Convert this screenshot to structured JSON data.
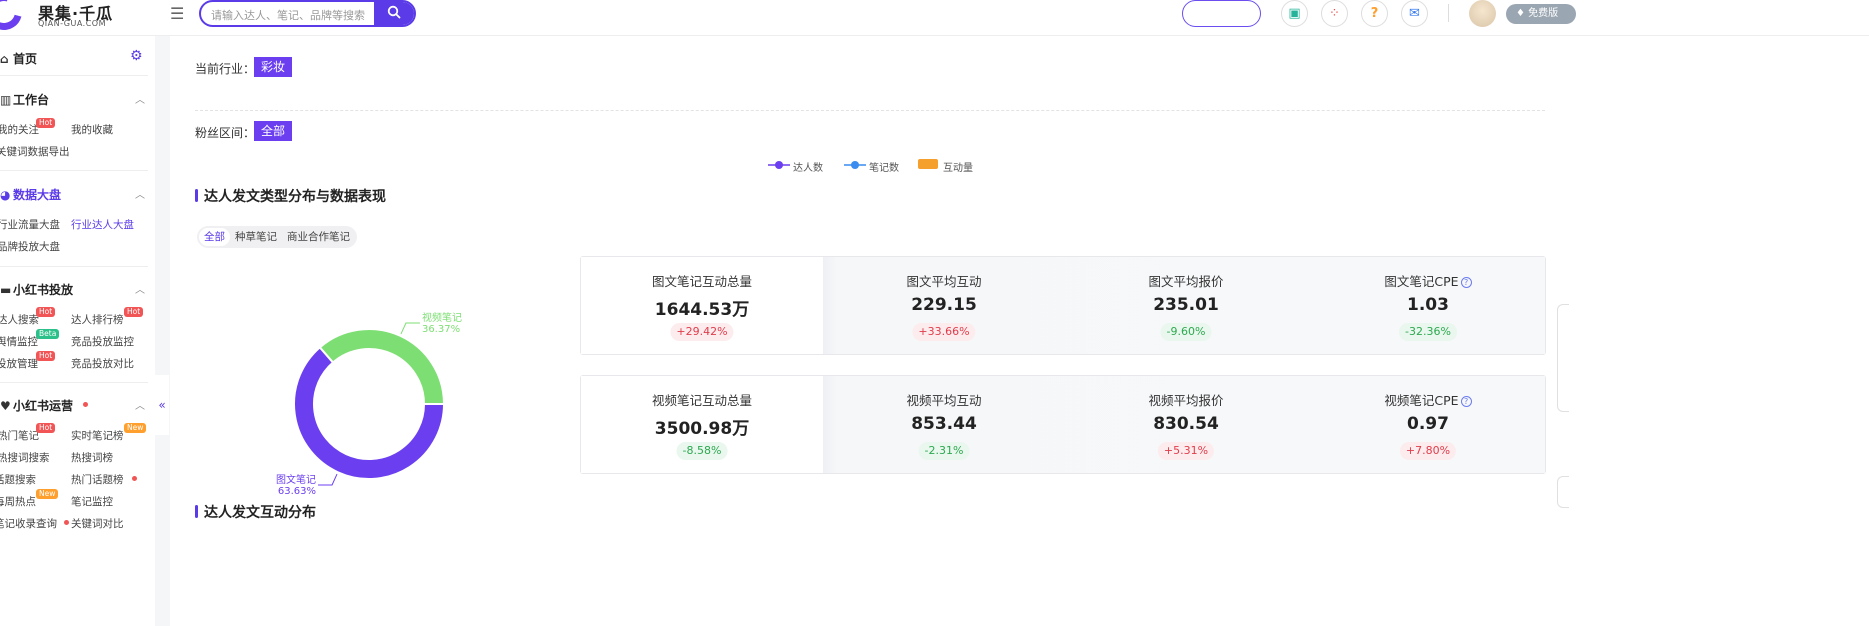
{
  "header": {
    "logo_text": "果集·千瓜",
    "logo_sub": "QIAN-GUA.COM",
    "search_placeholder": "请输入达人、笔记、品牌等搜索",
    "free_label": "免费版",
    "accent_color": "#5b3be8"
  },
  "sidebar": {
    "home": "首页",
    "sections": [
      {
        "title": "工作台",
        "items": [
          "我的关注",
          "我的收藏",
          "关键词数据导出"
        ]
      },
      {
        "title": "数据大盘",
        "items": [
          "行业流量大盘",
          "行业达人大盘",
          "品牌投放大盘"
        ]
      },
      {
        "title": "小红书投放",
        "items": [
          "达人搜索",
          "达人排行榜",
          "舆情监控",
          "竞品投放监控",
          "投放管理",
          "竞品投放对比"
        ]
      },
      {
        "title": "小红书运营",
        "items": [
          "热门笔记",
          "实时笔记榜",
          "热搜词搜索",
          "热搜词榜",
          "话题搜索",
          "热门话题榜",
          "每周热点",
          "笔记监控",
          "笔记收录查询",
          "关键词对比"
        ]
      }
    ],
    "tags": {
      "hot": "Hot",
      "beta": "Beta",
      "new": "New"
    }
  },
  "filters": {
    "industry_label": "当前行业：",
    "industry_value": "彩妆",
    "fans_label": "粉丝区间：",
    "fans_value": "全部"
  },
  "legend": [
    "达人数",
    "笔记数",
    "互动量"
  ],
  "section1": {
    "title": "达人发文类型分布与数据表现",
    "tabs": [
      "全部",
      "种草笔记",
      "商业合作笔记"
    ]
  },
  "chart_data": {
    "type": "pie",
    "donut": true,
    "categories": [
      "图文笔记",
      "视频笔记"
    ],
    "values": [
      63.63,
      36.37
    ],
    "value_labels": [
      "63.63%",
      "36.37%"
    ],
    "colors": [
      "#6b3ff0",
      "#7ddf73"
    ]
  },
  "cards": [
    [
      {
        "title": "图文笔记互动总量",
        "value": "1644.53万",
        "delta": "+29.42%",
        "dir": "up"
      },
      {
        "title": "图文平均互动",
        "value": "229.15",
        "delta": "+33.66%",
        "dir": "up"
      },
      {
        "title": "图文平均报价",
        "value": "235.01",
        "delta": "-9.60%",
        "dir": "down"
      },
      {
        "title": "图文笔记CPE",
        "value": "1.03",
        "delta": "-32.36%",
        "dir": "down",
        "help": "?"
      }
    ],
    [
      {
        "title": "视频笔记互动总量",
        "value": "3500.98万",
        "delta": "-8.58%",
        "dir": "down"
      },
      {
        "title": "视频平均互动",
        "value": "853.44",
        "delta": "-2.31%",
        "dir": "down"
      },
      {
        "title": "视频平均报价",
        "value": "830.54",
        "delta": "+5.31%",
        "dir": "up"
      },
      {
        "title": "视频笔记CPE",
        "value": "0.97",
        "delta": "+7.80%",
        "dir": "up",
        "help": "?"
      }
    ]
  ],
  "section2": {
    "title": "达人发文互动分布"
  }
}
